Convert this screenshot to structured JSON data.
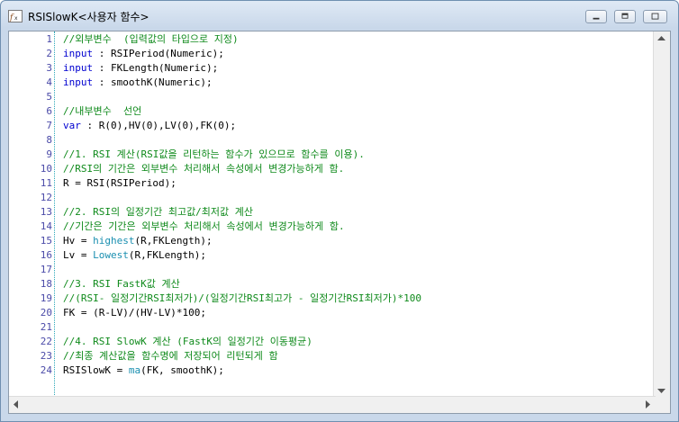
{
  "window": {
    "title": "RSISlowK<사용자 함수>",
    "icon": "function-icon"
  },
  "editor": {
    "lines": [
      {
        "n": "1",
        "parts": [
          {
            "c": "cm",
            "t": "//외부변수  (입력값의 타입으로 지정)"
          }
        ]
      },
      {
        "n": "2",
        "parts": [
          {
            "c": "kw",
            "t": "input"
          },
          {
            "c": "nm",
            "t": " : RSIPeriod(Numeric);"
          }
        ]
      },
      {
        "n": "3",
        "parts": [
          {
            "c": "kw",
            "t": "input"
          },
          {
            "c": "nm",
            "t": " : FKLength(Numeric);"
          }
        ]
      },
      {
        "n": "4",
        "parts": [
          {
            "c": "kw",
            "t": "input"
          },
          {
            "c": "nm",
            "t": " : smoothK(Numeric);"
          }
        ]
      },
      {
        "n": "5",
        "parts": []
      },
      {
        "n": "6",
        "parts": [
          {
            "c": "cm",
            "t": "//내부변수  선언"
          }
        ]
      },
      {
        "n": "7",
        "parts": [
          {
            "c": "kw",
            "t": "var"
          },
          {
            "c": "nm",
            "t": " : R(0),HV(0),LV(0),FK(0);"
          }
        ]
      },
      {
        "n": "8",
        "parts": []
      },
      {
        "n": "9",
        "parts": [
          {
            "c": "cm",
            "t": "//1. RSI 계산(RSI값을 리턴하는 함수가 있으므로 함수를 이용)."
          }
        ]
      },
      {
        "n": "10",
        "parts": [
          {
            "c": "cm",
            "t": "//RSI의 기간은 외부변수 처리해서 속성에서 변경가능하게 함."
          }
        ]
      },
      {
        "n": "11",
        "parts": [
          {
            "c": "nm",
            "t": "R = RSI(RSIPeriod);"
          }
        ]
      },
      {
        "n": "12",
        "parts": []
      },
      {
        "n": "13",
        "parts": [
          {
            "c": "cm",
            "t": "//2. RSI의 일정기간 최고값/최저값 계산"
          }
        ]
      },
      {
        "n": "14",
        "parts": [
          {
            "c": "cm",
            "t": "//기간은 기간은 외부변수 처리해서 속성에서 변경가능하게 함."
          }
        ]
      },
      {
        "n": "15",
        "parts": [
          {
            "c": "nm",
            "t": "Hv = "
          },
          {
            "c": "fn",
            "t": "highest"
          },
          {
            "c": "nm",
            "t": "(R,FKLength);"
          }
        ]
      },
      {
        "n": "16",
        "parts": [
          {
            "c": "nm",
            "t": "Lv = "
          },
          {
            "c": "fn",
            "t": "Lowest"
          },
          {
            "c": "nm",
            "t": "(R,FKLength);"
          }
        ]
      },
      {
        "n": "17",
        "parts": []
      },
      {
        "n": "18",
        "parts": [
          {
            "c": "cm",
            "t": "//3. RSI FastK값 계산"
          }
        ]
      },
      {
        "n": "19",
        "parts": [
          {
            "c": "cm",
            "t": "//(RSI- 일정기간RSI최저가)/(일정기간RSI최고가 - 일정기간RSI최저가)*100"
          }
        ]
      },
      {
        "n": "20",
        "parts": [
          {
            "c": "nm",
            "t": "FK = (R-LV)/(HV-LV)*100;"
          }
        ]
      },
      {
        "n": "21",
        "parts": []
      },
      {
        "n": "22",
        "parts": [
          {
            "c": "cm",
            "t": "//4. RSI SlowK 계산 (FastK의 일정기간 이동평균)"
          }
        ]
      },
      {
        "n": "23",
        "parts": [
          {
            "c": "cm",
            "t": "//최종 계산값을 함수명에 저장되어 리턴되게 함"
          }
        ]
      },
      {
        "n": "24",
        "parts": [
          {
            "c": "nm",
            "t": "RSISlowK = "
          },
          {
            "c": "fn",
            "t": "ma"
          },
          {
            "c": "nm",
            "t": "(FK, smoothK);"
          }
        ]
      }
    ]
  },
  "colors": {
    "comment": "#0f8a1b",
    "keyword": "#0000d0",
    "function": "#1a8fb0",
    "line_number": "#4a4aa8"
  }
}
